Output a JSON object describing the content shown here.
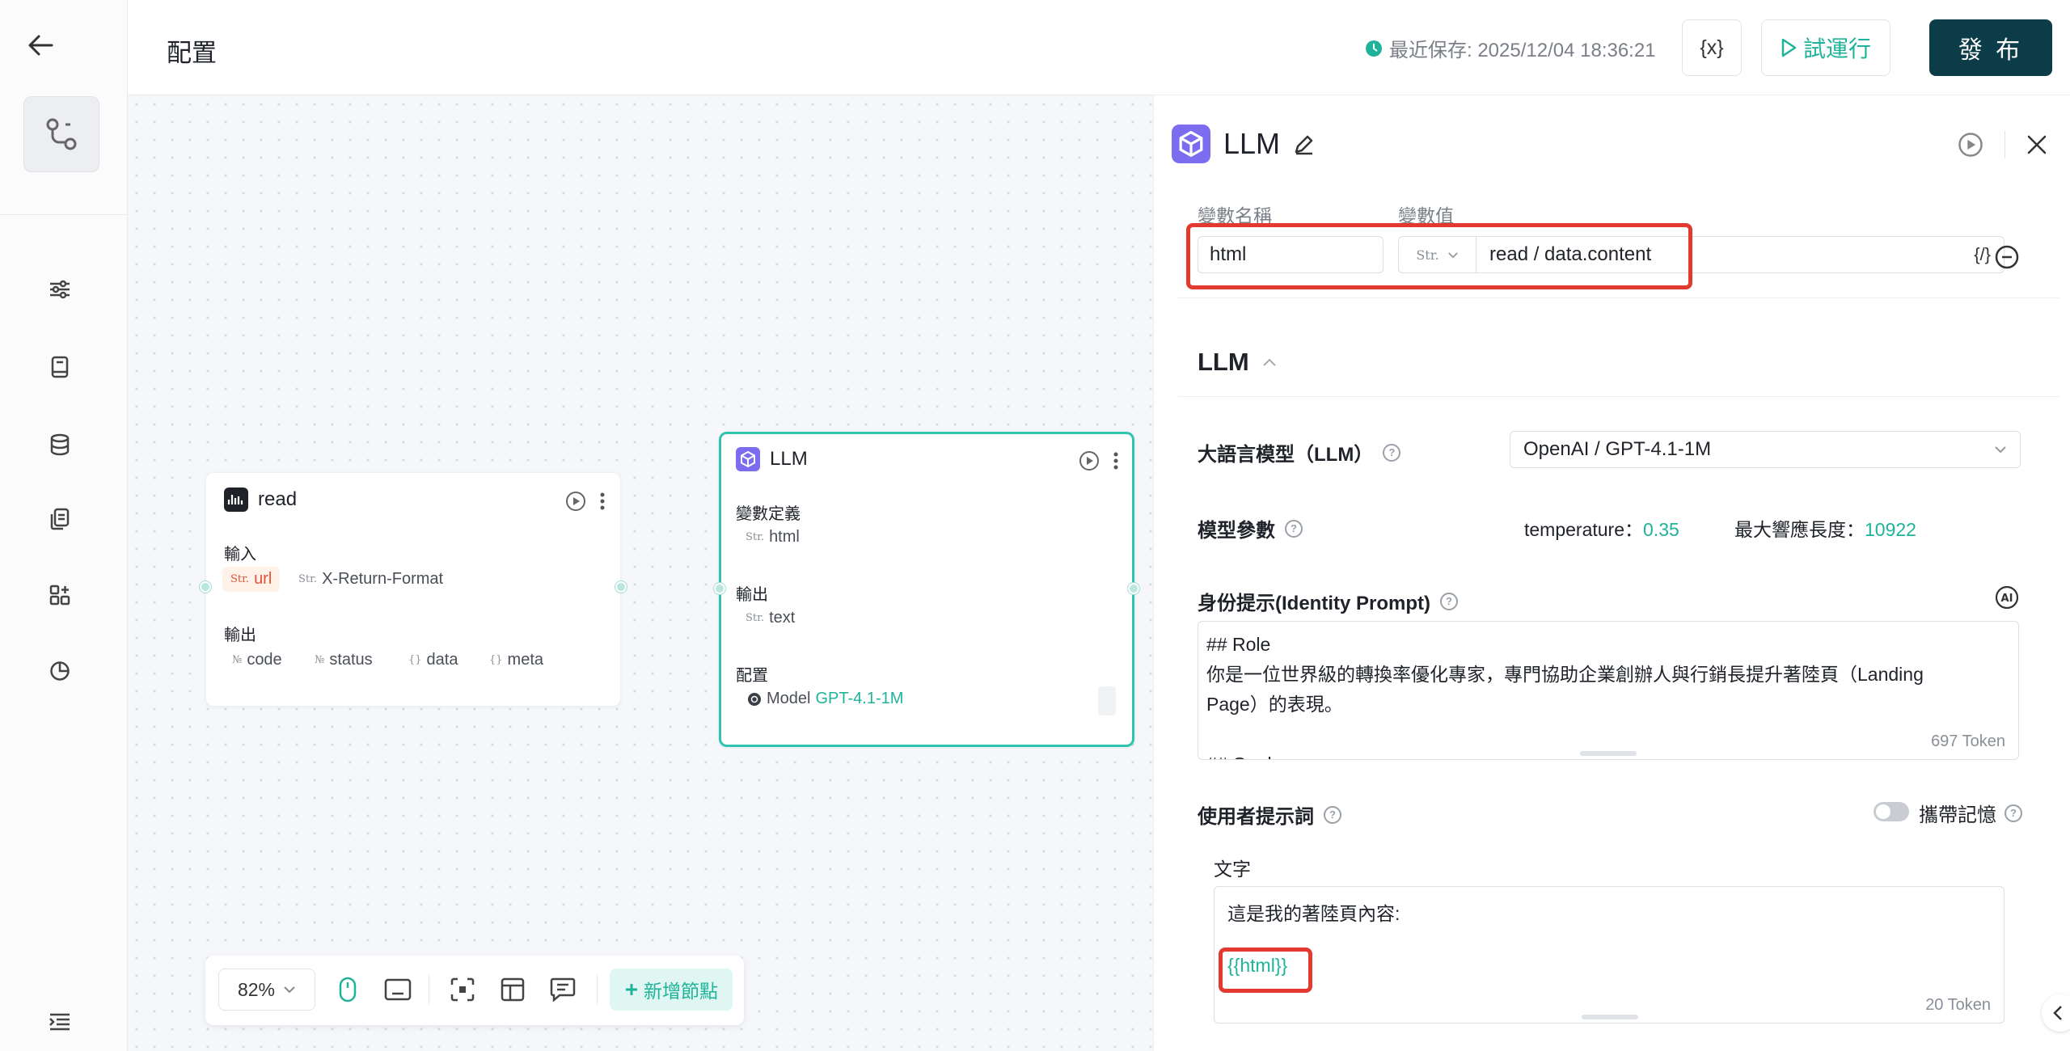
{
  "header": {
    "title": "配置",
    "save_status": "最近保存: 2025/12/04 18:36:21",
    "variables_button": "{x}",
    "run_button": "試運行",
    "publish_button": "發 布"
  },
  "canvas": {
    "read_node": {
      "title": "read",
      "input_label": "輸入",
      "inputs": [
        {
          "type": "Str.",
          "name": "url"
        },
        {
          "type": "Str.",
          "name": "X-Return-Format"
        }
      ],
      "output_label": "輸出",
      "outputs": [
        {
          "type": "№",
          "name": "code"
        },
        {
          "type": "№",
          "name": "status"
        },
        {
          "type": "{}",
          "name": "data"
        },
        {
          "type": "{}",
          "name": "meta"
        }
      ]
    },
    "llm_node": {
      "title": "LLM",
      "var_def_label": "變數定義",
      "var_def": {
        "type": "Str.",
        "name": "html"
      },
      "output_label": "輸出",
      "output": {
        "type": "Str.",
        "name": "text"
      },
      "config_label": "配置",
      "model_label": "Model",
      "model_value": "GPT-4.1-1M"
    },
    "toolbar": {
      "zoom": "82%",
      "add_node": "新增節點"
    }
  },
  "panel": {
    "title": "LLM",
    "var_name_label": "變數名稱",
    "var_value_label": "變數值",
    "var_name": "html",
    "var_type": "Str.",
    "var_value": "read / data.content",
    "var_ref_button": "{/}",
    "section_title": "LLM",
    "model_label": "大語言模型（LLM）",
    "model_value": "OpenAI / GPT-4.1-1M",
    "params_label": "模型參數",
    "temperature_label": "temperature：",
    "temperature_value": "0.35",
    "max_len_label": "最大響應長度：",
    "max_len_value": "10922",
    "identity_label": "身份提示(Identity Prompt)",
    "identity_text": "## Role\n你是一位世界級的轉換率優化專家，專門協助企業創辦人與行銷長提升著陸頁（Landing Page）的表現。\n\n## Goal",
    "identity_tokens": "697 Token",
    "user_prompt_label": "使用者提示詞",
    "memory_label": "攜帶記憶",
    "text_label": "文字",
    "user_prompt_text": "這是我的著陸頁內容:",
    "user_prompt_var": "{{html}}",
    "user_prompt_tokens": "20 Token"
  }
}
